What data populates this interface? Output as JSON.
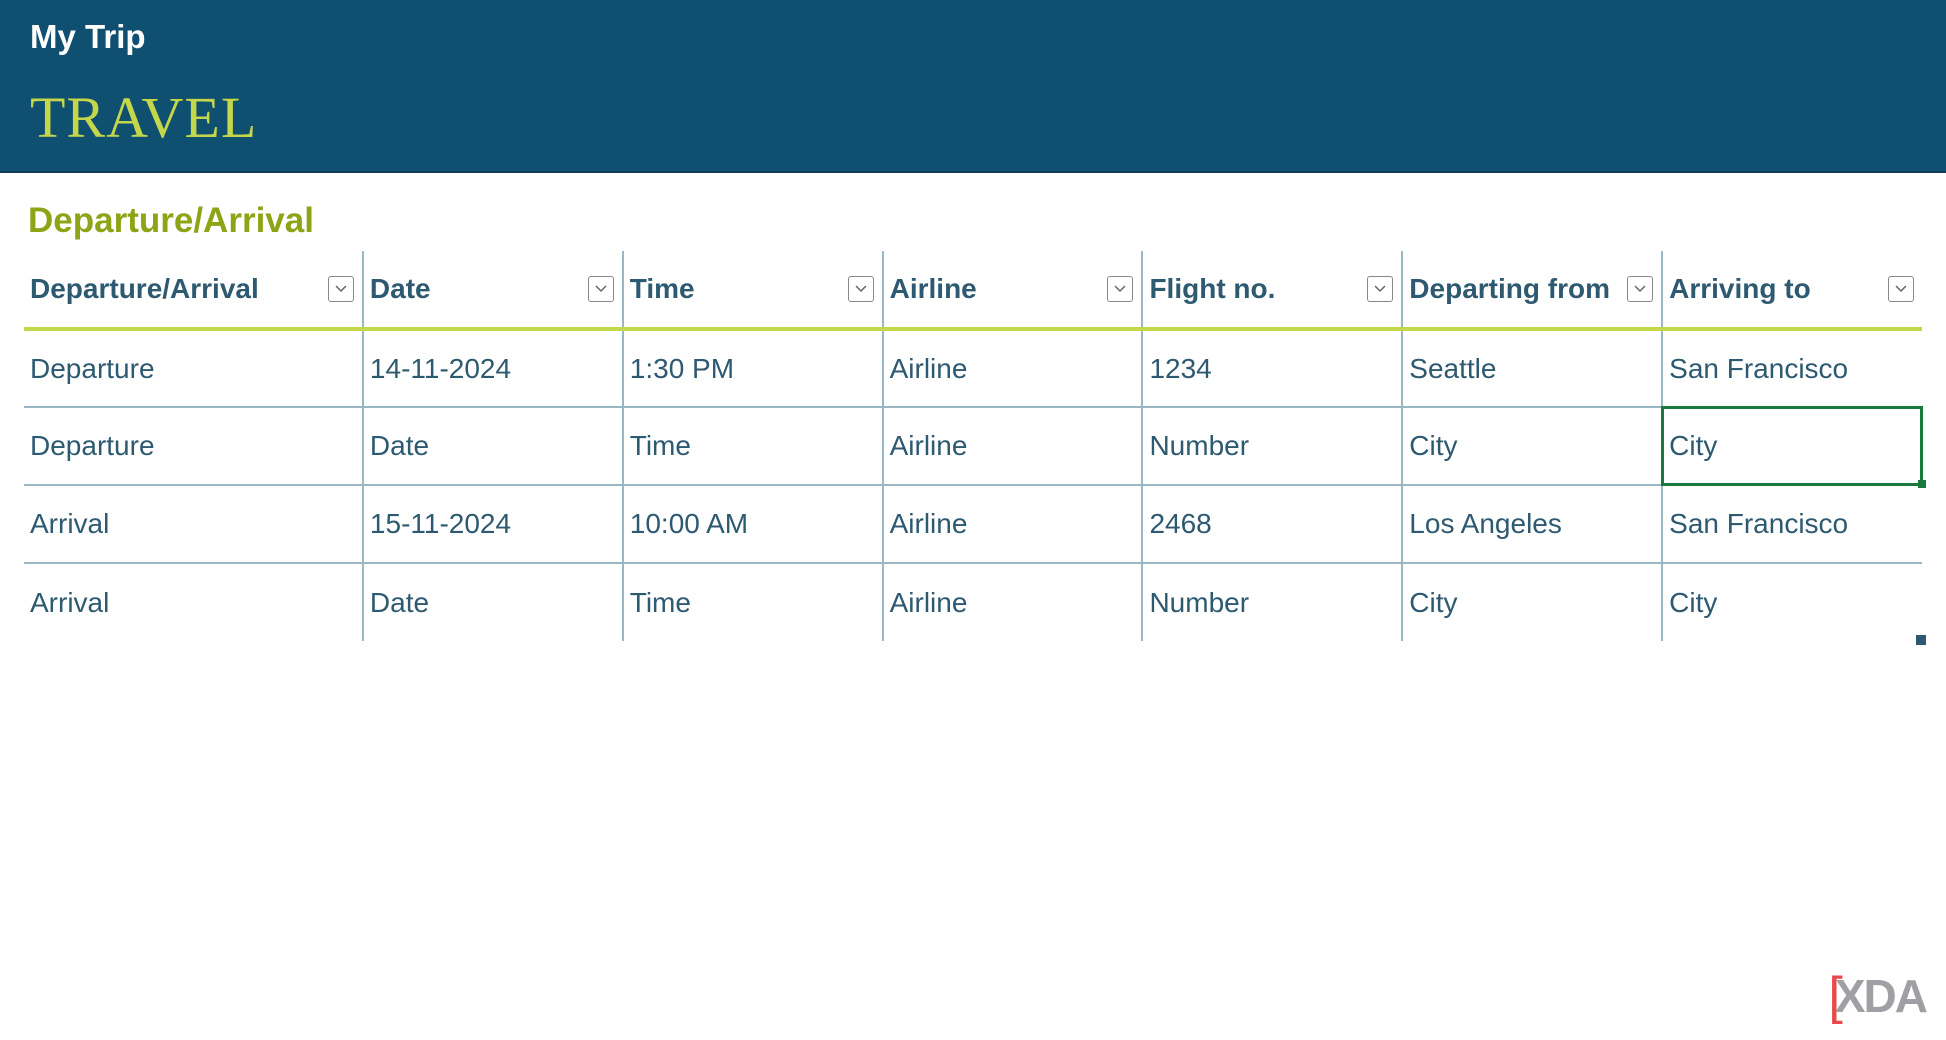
{
  "header": {
    "title": "My Trip",
    "subtitle": "TRAVEL"
  },
  "section": {
    "title": "Departure/Arrival"
  },
  "table": {
    "columns": [
      "Departure/Arrival",
      "Date",
      "Time",
      "Airline",
      "Flight no.",
      "Departing from",
      "Arriving to"
    ],
    "rows": [
      {
        "type": "Departure",
        "date": "14-11-2024",
        "time": "1:30 PM",
        "airline": "Airline",
        "flight_no": "1234",
        "departing_from": "Seattle",
        "arriving_to": "San Francisco"
      },
      {
        "type": "Departure",
        "date": "Date",
        "time": "Time",
        "airline": "Airline",
        "flight_no": "Number",
        "departing_from": "City",
        "arriving_to": "City"
      },
      {
        "type": "Arrival",
        "date": "15-11-2024",
        "time": "10:00 AM",
        "airline": "Airline",
        "flight_no": "2468",
        "departing_from": "Los Angeles",
        "arriving_to": "San Francisco"
      },
      {
        "type": "Arrival",
        "date": "Date",
        "time": "Time",
        "airline": "Airline",
        "flight_no": "Number",
        "departing_from": "City",
        "arriving_to": "City"
      }
    ],
    "selected_cell": {
      "row": 1,
      "col": 6
    }
  },
  "watermark": "XDA"
}
